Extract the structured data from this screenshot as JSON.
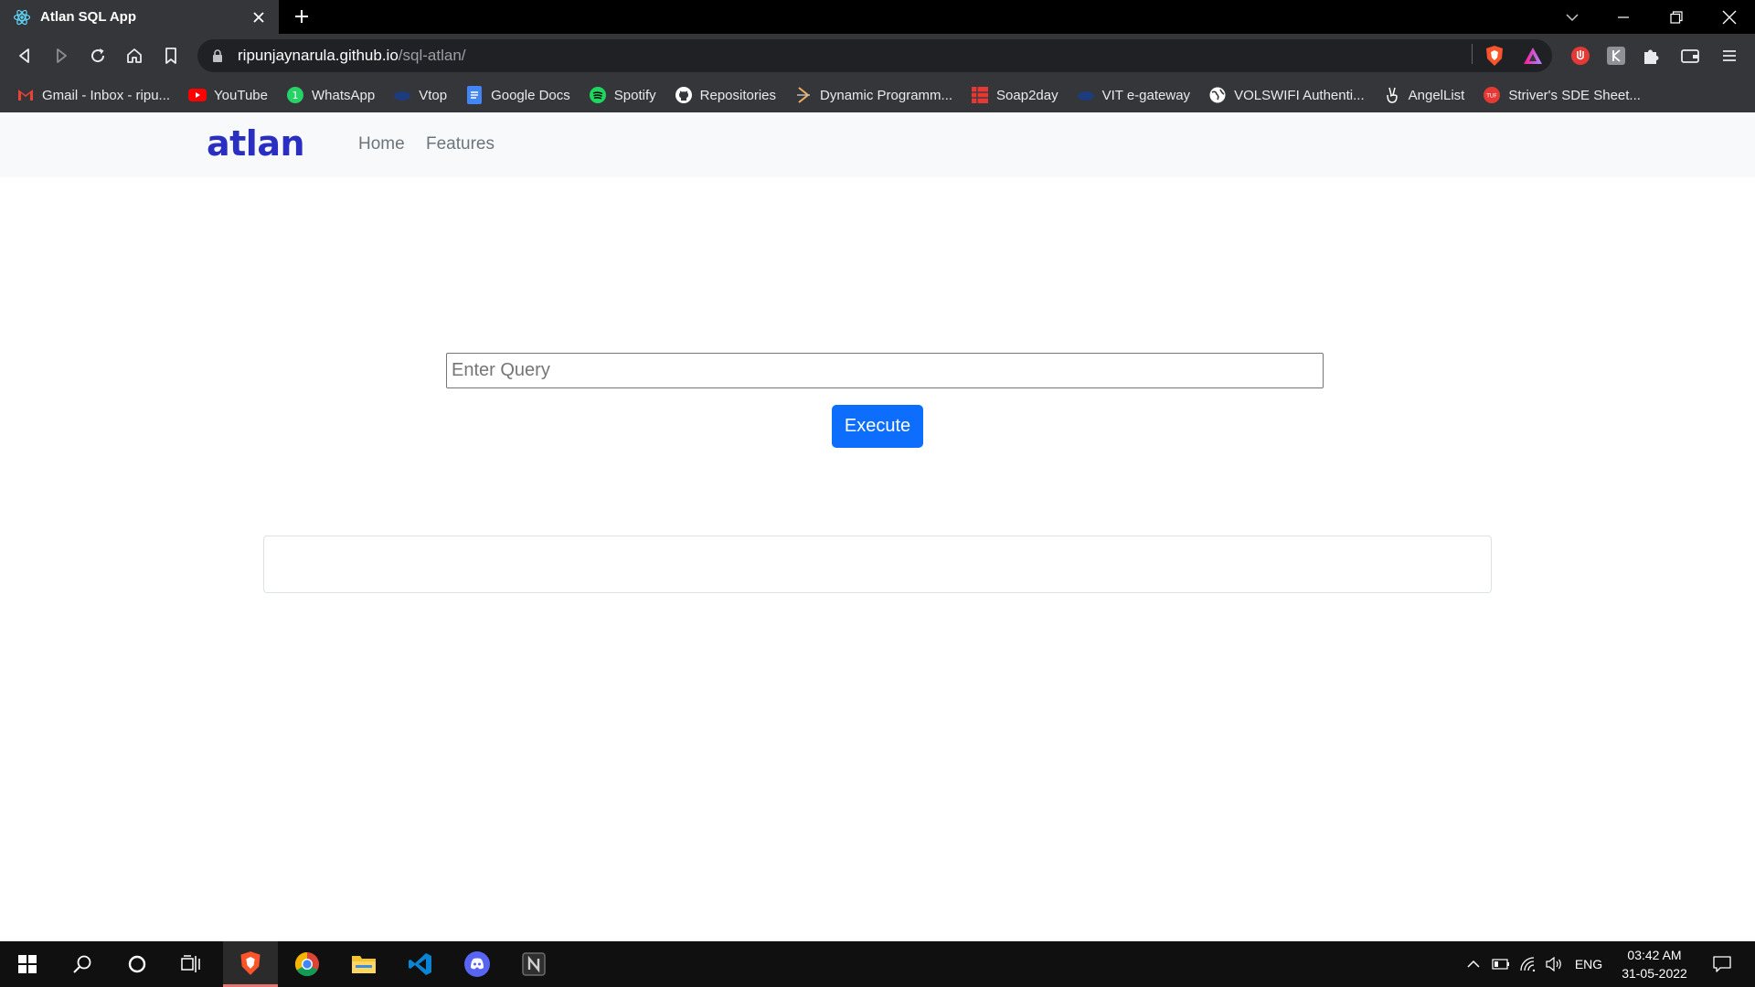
{
  "browser": {
    "tab": {
      "title": "Atlan SQL App",
      "favicon": "react-atom-icon"
    },
    "address": {
      "host": "ripunjaynarula.github.io",
      "path": "/sql-atlan/"
    },
    "bookmarks": [
      {
        "label": "Gmail - Inbox - ripu...",
        "icon": "gmail-icon",
        "color": "#ea4335"
      },
      {
        "label": "YouTube",
        "icon": "youtube-icon",
        "color": "#ff0000"
      },
      {
        "label": "WhatsApp",
        "icon": "whatsapp-icon",
        "color": "#25d366"
      },
      {
        "label": "Vtop",
        "icon": "vtop-icon",
        "color": "#1c3c7c"
      },
      {
        "label": "Google Docs",
        "icon": "google-docs-icon",
        "color": "#4285f4"
      },
      {
        "label": "Spotify",
        "icon": "spotify-icon",
        "color": "#1ed760"
      },
      {
        "label": "Repositories",
        "icon": "github-icon",
        "color": "#ffffff"
      },
      {
        "label": "Dynamic Programm...",
        "icon": "dp-icon",
        "color": "#f0b060"
      },
      {
        "label": "Soap2day",
        "icon": "soap2day-icon",
        "color": "#e53935"
      },
      {
        "label": "VIT e-gateway",
        "icon": "vit-icon",
        "color": "#1c3c7c"
      },
      {
        "label": "VOLSWIFI Authenti...",
        "icon": "globe-icon",
        "color": "#ffffff"
      },
      {
        "label": "AngelList",
        "icon": "angellist-icon",
        "color": "#ffffff"
      },
      {
        "label": "Striver's SDE Sheet...",
        "icon": "tuf-icon",
        "color": "#e53935"
      }
    ]
  },
  "app": {
    "brand": "atlan",
    "nav": [
      {
        "label": "Home"
      },
      {
        "label": "Features"
      }
    ],
    "query": {
      "placeholder": "Enter Query",
      "value": ""
    },
    "execute_label": "Execute",
    "colors": {
      "brand": "#2a2fc2",
      "primary": "#0d6efd",
      "navbar": "#f8f9fa"
    }
  },
  "taskbar": {
    "apps": [
      "brave-icon",
      "chrome-icon",
      "file-explorer-icon",
      "vscode-icon",
      "discord-icon",
      "notion-icon"
    ],
    "language": "ENG",
    "time": "03:42 AM",
    "date": "31-05-2022"
  }
}
